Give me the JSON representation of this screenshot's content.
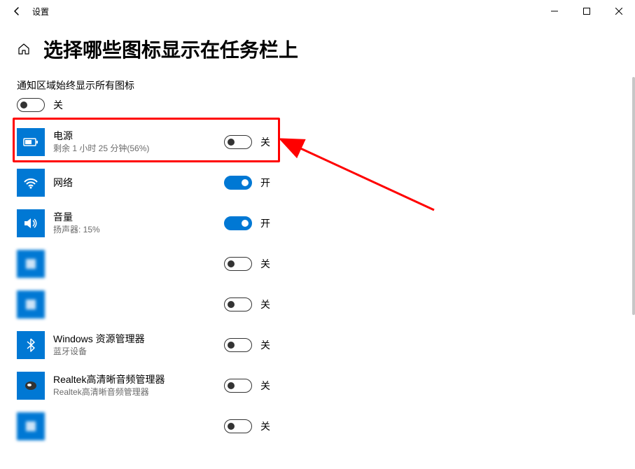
{
  "window": {
    "title": "设置"
  },
  "header": {
    "page_title": "选择哪些图标显示在任务栏上"
  },
  "master": {
    "label": "通知区域始终显示所有图标",
    "state_label": "关",
    "on": false
  },
  "state_labels": {
    "on": "开",
    "off": "关"
  },
  "rows": [
    {
      "id": "power",
      "title": "电源",
      "sub": "剩余 1 小时 25 分钟(56%)",
      "on": false,
      "blur": false,
      "icon": "battery"
    },
    {
      "id": "network",
      "title": "网络",
      "sub": "",
      "on": true,
      "blur": false,
      "icon": "wifi"
    },
    {
      "id": "volume",
      "title": "音量",
      "sub": "扬声器: 15%",
      "on": true,
      "blur": false,
      "icon": "speaker"
    },
    {
      "id": "blur1",
      "title": "　　　　　",
      "sub": "",
      "on": false,
      "blur": true,
      "icon": "generic"
    },
    {
      "id": "blur2",
      "title": "　　　　　　　　　",
      "sub": "　　　　　　　　　",
      "on": false,
      "blur": true,
      "icon": "generic"
    },
    {
      "id": "explorer",
      "title": "Windows 资源管理器",
      "sub": "蓝牙设备",
      "on": false,
      "blur": false,
      "icon": "bluetooth"
    },
    {
      "id": "realtek",
      "title": "Realtek高清晰音频管理器",
      "sub": "Realtek高清晰音频管理器",
      "on": false,
      "blur": false,
      "icon": "realtek"
    },
    {
      "id": "blur3",
      "title": "　　　　　",
      "sub": "",
      "on": false,
      "blur": true,
      "icon": "generic"
    }
  ],
  "annotation": {
    "highlight_row_index": 0
  }
}
